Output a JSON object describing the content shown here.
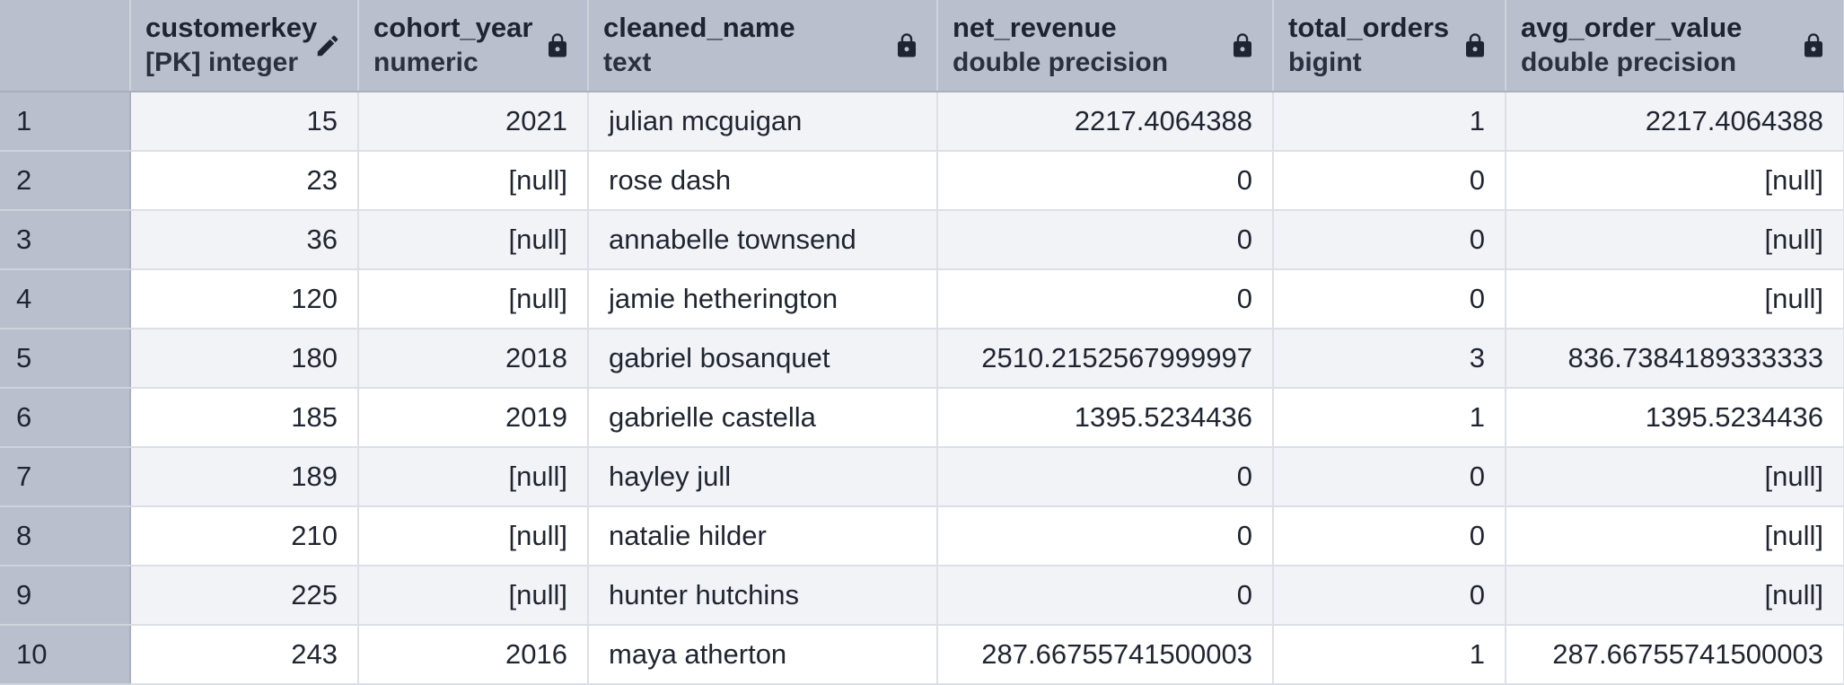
{
  "columns": [
    {
      "name": "customerkey",
      "type": "[PK] integer",
      "icon": "pencil-icon"
    },
    {
      "name": "cohort_year",
      "type": "numeric",
      "icon": "lock-icon"
    },
    {
      "name": "cleaned_name",
      "type": "text",
      "icon": "lock-icon"
    },
    {
      "name": "net_revenue",
      "type": "double precision",
      "icon": "lock-icon"
    },
    {
      "name": "total_orders",
      "type": "bigint",
      "icon": "lock-icon"
    },
    {
      "name": "avg_order_value",
      "type": "double precision",
      "icon": "lock-icon"
    }
  ],
  "rows": [
    {
      "n": "1",
      "c": [
        "15",
        "2021",
        "julian mcguigan",
        "2217.4064388",
        "1",
        "2217.4064388"
      ]
    },
    {
      "n": "2",
      "c": [
        "23",
        "[null]",
        "rose dash",
        "0",
        "0",
        "[null]"
      ]
    },
    {
      "n": "3",
      "c": [
        "36",
        "[null]",
        "annabelle townsend",
        "0",
        "0",
        "[null]"
      ]
    },
    {
      "n": "4",
      "c": [
        "120",
        "[null]",
        "jamie hetherington",
        "0",
        "0",
        "[null]"
      ]
    },
    {
      "n": "5",
      "c": [
        "180",
        "2018",
        "gabriel bosanquet",
        "2510.2152567999997",
        "3",
        "836.7384189333333"
      ]
    },
    {
      "n": "6",
      "c": [
        "185",
        "2019",
        "gabrielle castella",
        "1395.5234436",
        "1",
        "1395.5234436"
      ]
    },
    {
      "n": "7",
      "c": [
        "189",
        "[null]",
        "hayley jull",
        "0",
        "0",
        "[null]"
      ]
    },
    {
      "n": "8",
      "c": [
        "210",
        "[null]",
        "natalie hilder",
        "0",
        "0",
        "[null]"
      ]
    },
    {
      "n": "9",
      "c": [
        "225",
        "[null]",
        "hunter hutchins",
        "0",
        "0",
        "[null]"
      ]
    },
    {
      "n": "10",
      "c": [
        "243",
        "2016",
        "maya atherton",
        "287.66755741500003",
        "1",
        "287.66755741500003"
      ]
    }
  ]
}
